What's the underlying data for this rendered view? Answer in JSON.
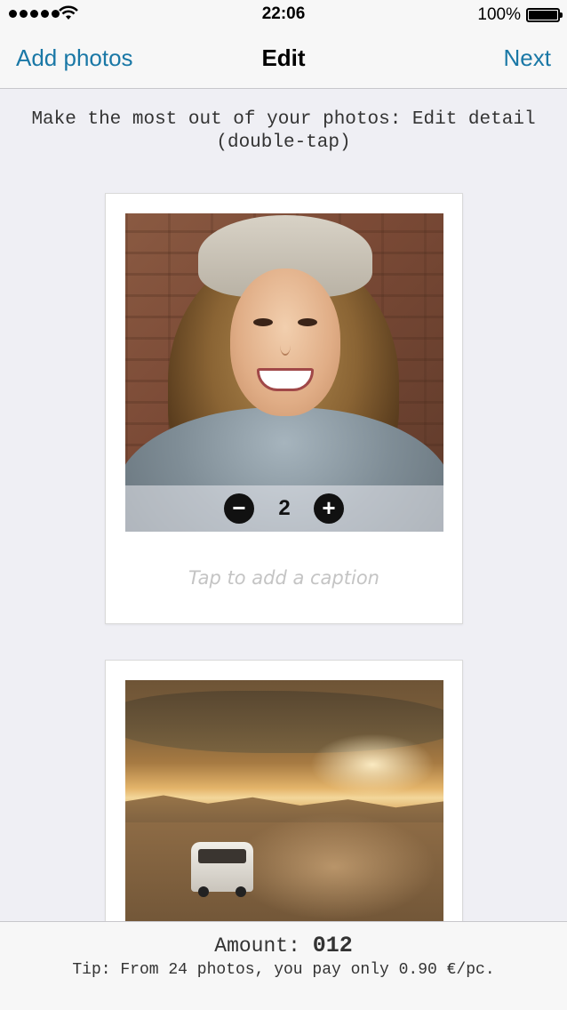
{
  "status_bar": {
    "time": "22:06",
    "battery_percent": "100%",
    "signal_icon": "signal-dots-icon",
    "wifi_icon": "wifi-icon",
    "battery_icon": "battery-full-icon"
  },
  "nav": {
    "left_label": "Add photos",
    "title": "Edit",
    "right_label": "Next",
    "accent_color": "#1a78a6"
  },
  "instruction": "Make the most out of your photos: Edit detail (double-tap)",
  "photos": [
    {
      "quantity": "2",
      "minus_icon": "minus-icon",
      "plus_icon": "plus-icon",
      "minus_label": "−",
      "plus_label": "+",
      "caption_placeholder": "Tap to add a caption"
    },
    {}
  ],
  "summary": {
    "amount_label": "Amount:",
    "amount_value": "012",
    "tip": "Tip: From 24 photos, you pay only 0.90 €/pc."
  }
}
